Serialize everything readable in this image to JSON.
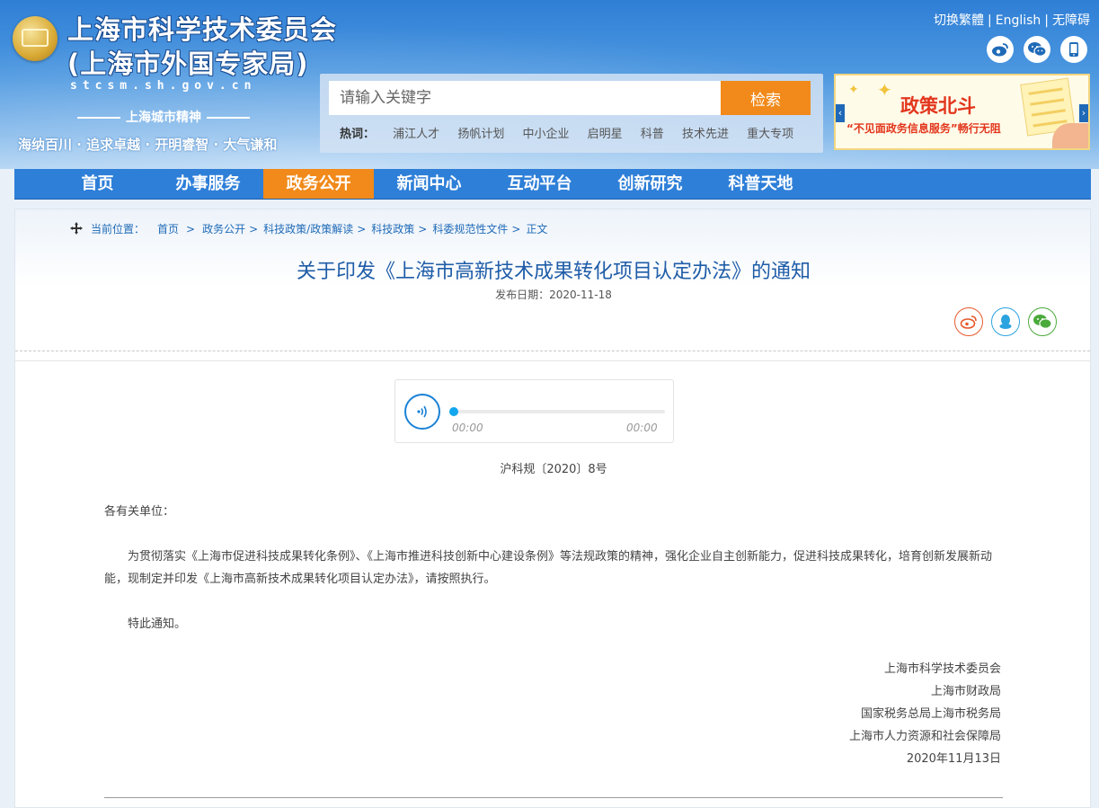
{
  "header": {
    "site_title": "上海市科学技术委员会",
    "site_subtitle": "(上海市外国专家局)",
    "site_domain": "stcsm.sh.gov.cn",
    "spirit_title": "上海城市精神",
    "spirit_text": "海纳百川 · 追求卓越 · 开明睿智 · 大气谦和",
    "top_links": [
      "切换繁體",
      "English",
      "无障碍"
    ],
    "social_icons": [
      "weibo-icon",
      "wechat-icon",
      "mobile-icon"
    ]
  },
  "search": {
    "placeholder": "请输入关键字",
    "button_label": "检索",
    "hot_label": "热词：",
    "hot_words": [
      "浦江人才",
      "扬帆计划",
      "中小企业",
      "启明星",
      "科普",
      "技术先进",
      "重大专项"
    ]
  },
  "banner": {
    "title": "政策北斗",
    "subtitle": "“不见面政务信息服务”畅行无阻"
  },
  "nav": {
    "items": [
      "首页",
      "办事服务",
      "政务公开",
      "新闻中心",
      "互动平台",
      "创新研究",
      "科普天地"
    ],
    "active_index": 2
  },
  "breadcrumb": {
    "position_label": "当前位置：",
    "items": [
      "首页",
      "政务公开",
      "科技政策/政策解读",
      "科技政策",
      "科委规范性文件",
      "正文"
    ],
    "separators": [
      ">",
      ">",
      ">",
      ">",
      ">"
    ]
  },
  "article": {
    "title": "关于印发《上海市高新技术成果转化项目认定办法》的通知",
    "publish_date": "发布日期：2020-11-18",
    "share_icons": [
      "weibo-icon",
      "qq-icon",
      "wechat-icon"
    ],
    "player": {
      "current_time": "00:00",
      "duration": "00:00",
      "progress": 0
    },
    "doc_number": "沪科规〔2020〕8号",
    "salutation": "各有关单位：",
    "paragraph": "为贯彻落实《上海市促进科技成果转化条例》、《上海市推进科技创新中心建设条例》等法规政策的精神，强化企业自主创新能力，促进科技成果转化，培育创新发展新动能，现制定并印发《上海市高新技术成果转化项目认定办法》，请按照执行。",
    "closing": "特此通知。",
    "signers": [
      "上海市科学技术委员会",
      "上海市财政局",
      "国家税务总局上海市税务局",
      "上海市人力资源和社会保障局",
      "2020年11月13日"
    ]
  },
  "colors": {
    "nav_bg": "#2e7fd8",
    "accent_orange": "#f18a1a",
    "title_blue": "#1f5da8",
    "link_blue": "#1f6ab7"
  }
}
